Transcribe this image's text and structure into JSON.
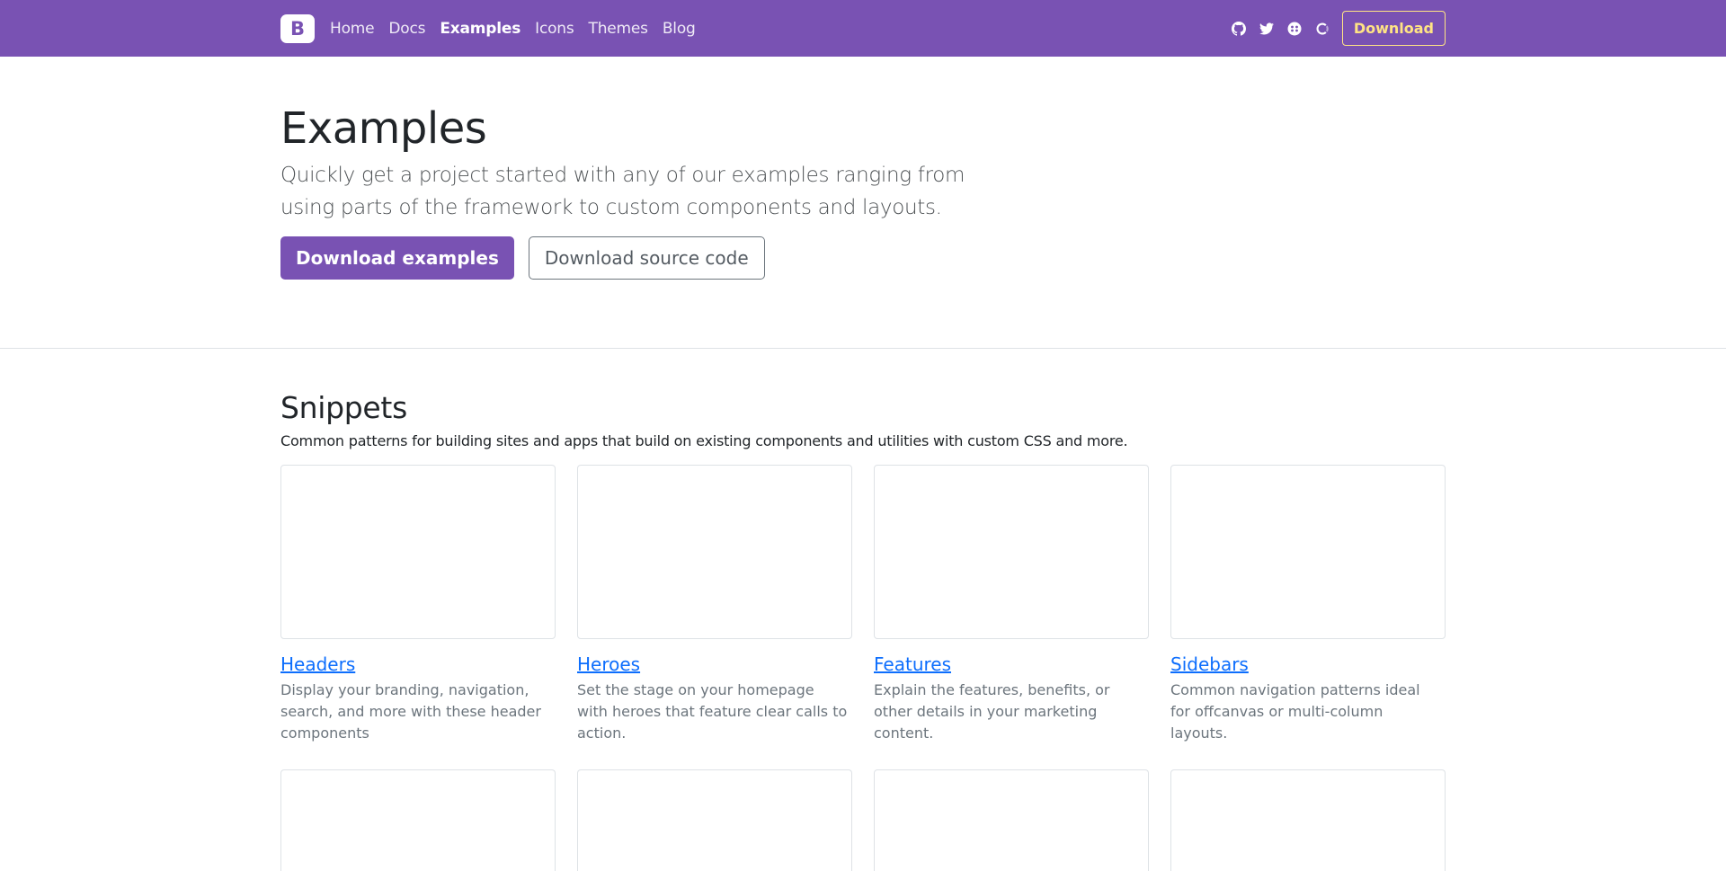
{
  "navbar": {
    "brand": "B",
    "links": [
      {
        "label": "Home",
        "active": false
      },
      {
        "label": "Docs",
        "active": false
      },
      {
        "label": "Examples",
        "active": true
      },
      {
        "label": "Icons",
        "active": false
      },
      {
        "label": "Themes",
        "active": false
      },
      {
        "label": "Blog",
        "active": false
      }
    ],
    "social_icons": [
      "github-icon",
      "twitter-icon",
      "slack-icon",
      "opencollective-icon"
    ],
    "download_label": "Download",
    "colors": {
      "background": "#7952b3",
      "download": "#ffe484"
    }
  },
  "hero": {
    "title": "Examples",
    "lead": "Quickly get a project started with any of our examples ranging from using parts of the framework to custom components and layouts.",
    "primary_button": "Download examples",
    "secondary_button": "Download source code"
  },
  "snippets": {
    "title": "Snippets",
    "description": "Common patterns for building sites and apps that build on existing components and utilities with custom CSS and more.",
    "cards": [
      {
        "title": "Headers",
        "text": "Display your branding, navigation, search, and more with these header components"
      },
      {
        "title": "Heroes",
        "text": "Set the stage on your homepage with heroes that feature clear calls to action."
      },
      {
        "title": "Features",
        "text": "Explain the features, benefits, or other details in your marketing content."
      },
      {
        "title": "Sidebars",
        "text": "Common navigation patterns ideal for offcanvas or multi-column layouts."
      }
    ]
  }
}
